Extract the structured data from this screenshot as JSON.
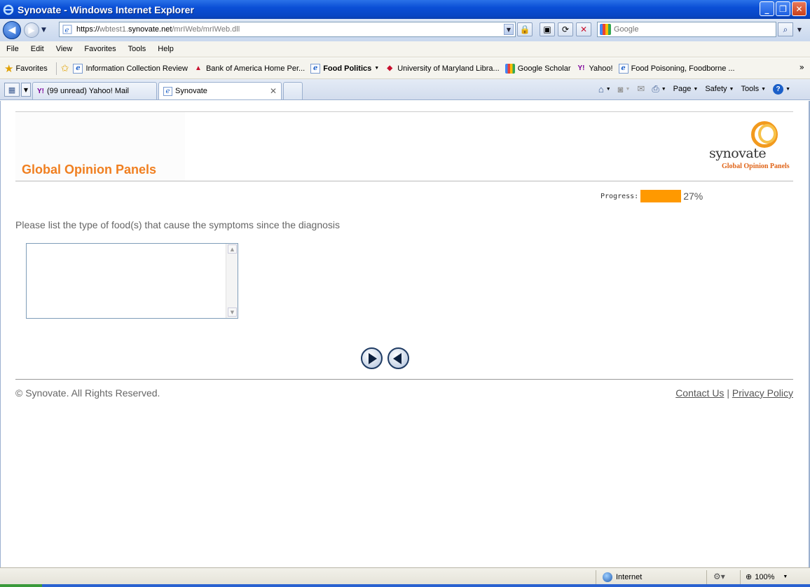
{
  "window": {
    "title": "Synovate - Windows Internet Explorer"
  },
  "address_bar": {
    "url_prefix": "https://",
    "url_host": "wbtest1.synovate.net",
    "url_path": "/mrIWeb/mrIWeb.dll"
  },
  "search": {
    "placeholder": "Google"
  },
  "menu": [
    "File",
    "Edit",
    "View",
    "Favorites",
    "Tools",
    "Help"
  ],
  "favorites": {
    "label": "Favorites",
    "links": [
      {
        "label": "Information Collection Review",
        "icon": "ie-page-icon"
      },
      {
        "label": "Bank of America  Home  Per...",
        "icon": "bank-of-america-icon"
      },
      {
        "label": "Food Politics",
        "icon": "ie-page-icon",
        "bold": true,
        "dropdown": true
      },
      {
        "label": "University of Maryland Libra...",
        "icon": "umd-icon"
      },
      {
        "label": "Google Scholar",
        "icon": "google-icon"
      },
      {
        "label": "Yahoo!",
        "icon": "yahoo-icon"
      },
      {
        "label": "Food Poisoning, Foodborne ...",
        "icon": "ie-page-icon"
      }
    ]
  },
  "tabs": [
    {
      "label": "(99 unread) Yahoo! Mail",
      "active": false
    },
    {
      "label": "Synovate",
      "active": true
    }
  ],
  "command_bar": {
    "page": "Page",
    "safety": "Safety",
    "tools": "Tools"
  },
  "survey": {
    "brand_title": "Global Opinion Panels",
    "logo_wordmark": "synovate",
    "logo_sub": "Global Opinion Panels",
    "progress_label": "Progress:",
    "progress_percent": 27,
    "progress_text": "27%",
    "question": "Please list the type of food(s) that cause the symptoms since the diagnosis",
    "answer_value": ""
  },
  "footer": {
    "copyright": "© Synovate. All Rights Reserved.",
    "contact": "Contact Us",
    "separator": "|",
    "privacy": "Privacy Policy"
  },
  "status_bar": {
    "zone": "Internet",
    "zoom": "100%"
  },
  "colors": {
    "brand_orange": "#f07f20",
    "progress_fill": "#ff9900"
  }
}
